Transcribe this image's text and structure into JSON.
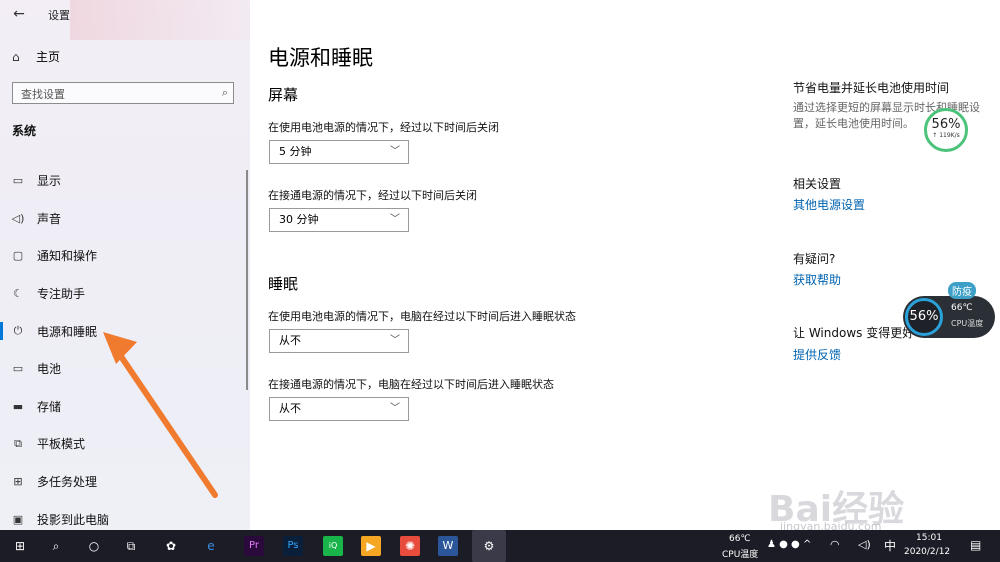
{
  "window": {
    "title": "设置",
    "back_icon": "back-arrow-icon",
    "min_icon": "minimize-icon",
    "max_icon": "restore-icon",
    "close_icon": "close-icon"
  },
  "sidebar": {
    "home_label": "主页",
    "search_placeholder": "查找设置",
    "section_title": "系统",
    "items": [
      {
        "label": "显示",
        "icon": "monitor-icon"
      },
      {
        "label": "声音",
        "icon": "speaker-icon"
      },
      {
        "label": "通知和操作",
        "icon": "notification-icon"
      },
      {
        "label": "专注助手",
        "icon": "moon-icon"
      },
      {
        "label": "电源和睡眠",
        "icon": "power-icon",
        "active": true
      },
      {
        "label": "电池",
        "icon": "battery-icon"
      },
      {
        "label": "存储",
        "icon": "storage-icon"
      },
      {
        "label": "平板模式",
        "icon": "tablet-icon"
      },
      {
        "label": "多任务处理",
        "icon": "multitask-icon"
      },
      {
        "label": "投影到此电脑",
        "icon": "project-icon"
      }
    ]
  },
  "main": {
    "title": "电源和睡眠",
    "screen": {
      "heading": "屏幕",
      "battery_desc": "在使用电池电源的情况下，经过以下时间后关闭",
      "battery_value": "5 分钟",
      "plugged_desc": "在接通电源的情况下，经过以下时间后关闭",
      "plugged_value": "30 分钟"
    },
    "sleep": {
      "heading": "睡眠",
      "battery_desc": "在使用电池电源的情况下，电脑在经过以下时间后进入睡眠状态",
      "battery_value": "从不",
      "plugged_desc": "在接通电源的情况下，电脑在经过以下时间后进入睡眠状态",
      "plugged_value": "从不"
    }
  },
  "side": {
    "save_heading": "节省电量并延长电池使用时间",
    "save_text": "通过选择更短的屏幕显示时长和睡眠设置，延长电池使用时间。",
    "related_heading": "相关设置",
    "related_link": "其他电源设置",
    "help_heading": "有疑问?",
    "help_link": "获取帮助",
    "feedback_heading": "让 Windows 变得更好",
    "feedback_link": "提供反馈"
  },
  "overlays": {
    "net_percent": "56%",
    "net_speed": "↑ 119K/s",
    "cpu_percent": "56%",
    "cpu_temp": "66℃",
    "cpu_label": "CPU温度",
    "badge": "防疫"
  },
  "taskbar": {
    "cpu_temp": "66℃",
    "cpu_label": "CPU温度",
    "ime": "中",
    "time": "15:01",
    "date": "2020/2/12"
  },
  "watermark": {
    "brand": "Bai经验",
    "url": "jingyan.baidu.com"
  },
  "colors": {
    "accent": "#0078d7",
    "link": "#0063b1",
    "arrow": "#f07a2e",
    "taskbar": "#1c1c26"
  }
}
